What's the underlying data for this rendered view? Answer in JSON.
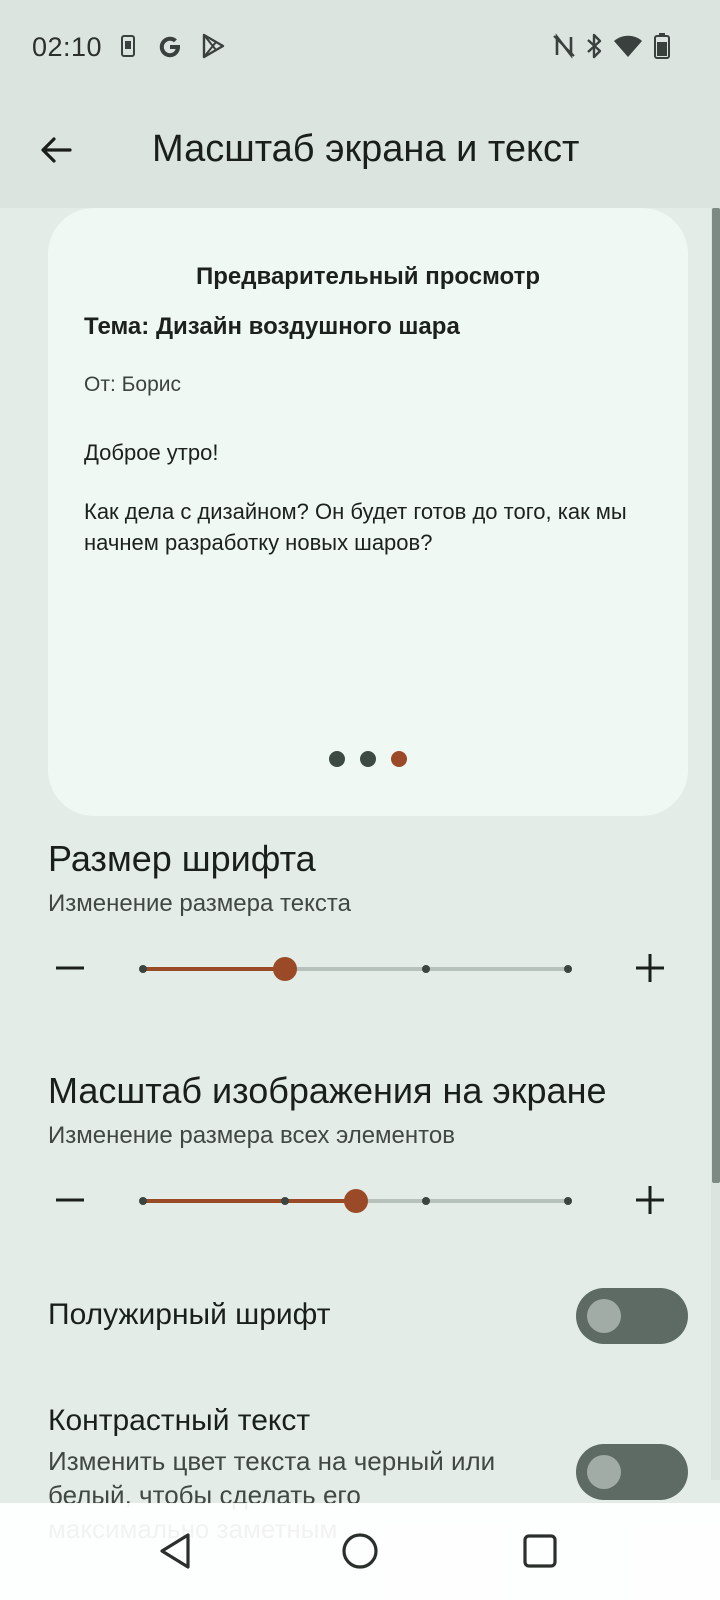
{
  "status_bar": {
    "time": "02:10",
    "left_icons": [
      "sim-card-icon",
      "google-g-icon",
      "play-store-icon"
    ],
    "right_icons": [
      "nfc-icon",
      "bluetooth-icon",
      "wifi-icon",
      "battery-icon"
    ]
  },
  "app_bar": {
    "title": "Масштаб экрана и текст",
    "back_icon": "arrow-back-icon"
  },
  "preview": {
    "heading": "Предварительный просмотр",
    "subject": "Тема: Дизайн воздушного шара",
    "from": "От: Борис",
    "greeting": "Доброе утро!",
    "body": "Как дела с дизайном? Он будет готов до того, как мы начнем разработку новых шаров?",
    "pages": 3,
    "current_page": 3
  },
  "font_size": {
    "title": "Размер шрифта",
    "subtitle": "Изменение размера текста",
    "steps": 4,
    "value_index": 1
  },
  "display_size": {
    "title": "Масштаб изображения на экране",
    "subtitle": "Изменение размера всех элементов",
    "steps": 4,
    "value_fraction": 0.5
  },
  "bold_text": {
    "label": "Полужирный шрифт",
    "enabled": false
  },
  "contrast_text": {
    "title": "Контрастный текст",
    "description": "Изменить цвет текста на черный или белый, чтобы сделать его максимально заметным",
    "enabled": false
  },
  "nav_bar": {
    "icons": [
      "nav-back-icon",
      "nav-home-icon",
      "nav-recents-icon"
    ]
  },
  "colors": {
    "background": "#e3ece6",
    "accent": "#9a4a27",
    "card": "#f0f8f3",
    "switch_off_track": "#5e6b64"
  }
}
